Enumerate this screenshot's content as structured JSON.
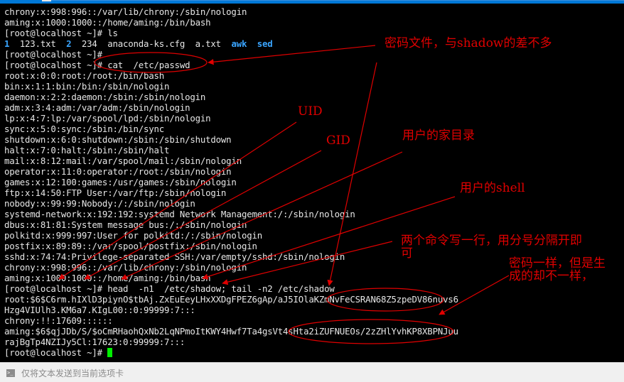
{
  "terminal": {
    "lines": [
      "chrony:x:998:996::/var/lib/chrony:/sbin/nologin",
      "aming:x:1000:1000::/home/aming:/bin/bash",
      "[root@localhost ~]# ls",
      "__LS__",
      "[root@localhost ~]#",
      "[root@localhost ~]# cat  /etc/passwd",
      "root:x:0:0:root:/root:/bin/bash",
      "bin:x:1:1:bin:/bin:/sbin/nologin",
      "daemon:x:2:2:daemon:/sbin:/sbin/nologin",
      "adm:x:3:4:adm:/var/adm:/sbin/nologin",
      "lp:x:4:7:lp:/var/spool/lpd:/sbin/nologin",
      "sync:x:5:0:sync:/sbin:/bin/sync",
      "shutdown:x:6:0:shutdown:/sbin:/sbin/shutdown",
      "halt:x:7:0:halt:/sbin:/sbin/halt",
      "mail:x:8:12:mail:/var/spool/mail:/sbin/nologin",
      "operator:x:11:0:operator:/root:/sbin/nologin",
      "games:x:12:100:games:/usr/games:/sbin/nologin",
      "ftp:x:14:50:FTP User:/var/ftp:/sbin/nologin",
      "nobody:x:99:99:Nobody:/:/sbin/nologin",
      "systemd-network:x:192:192:systemd Network Management:/:/sbin/nologin",
      "dbus:x:81:81:System message bus:/:/sbin/nologin",
      "polkitd:x:999:997:User for polkitd:/:/sbin/nologin",
      "postfix:x:89:89::/var/spool/postfix:/sbin/nologin",
      "sshd:x:74:74:Privilege-separated SSH:/var/empty/sshd:/sbin/nologin",
      "chrony:x:998:996::/var/lib/chrony:/sbin/nologin",
      "aming:x:1000:1000::/home/aming:/bin/bash",
      "[root@localhost ~]# head  -n1  /etc/shadow; tail -n2 /etc/shadow",
      "root:$6$C6rm.hIXlD3piynO$tbAj.ZxEuEeyLHxXXDgFPEZ6gAp/aJ5IOlaKZmNvFeCSRAN68Z5zpeDV86nuvs6",
      "Hzg4VIUlh3.KM6a7.KIgL00::0:99999:7:::",
      "chrony:!!:17609::::::",
      "aming:$6$qjJDb/S/$oCmRHaohQxNb2LqNPmoItKWY4Hwf7Ta4gsVt4sHta2iZUFNUEOs/2zZHlYvhKP8XBPNJuu",
      "rajBgTp4NZIJy5Cl:17623:0:99999:7:::"
    ],
    "ls_output": [
      {
        "text": "1",
        "dir": true
      },
      {
        "text": "  123.txt  ",
        "dir": false
      },
      {
        "text": "2",
        "dir": true
      },
      {
        "text": "  234  anaconda-ks.cfg  a.txt  ",
        "dir": false
      },
      {
        "text": "awk",
        "dir": true
      },
      {
        "text": "  ",
        "dir": false
      },
      {
        "text": "sed",
        "dir": true
      }
    ],
    "prompt": "[root@localhost ~]# ",
    "colors": {
      "text": "#e6e6e6",
      "directory": "#3aa5ff",
      "cursor": "#00ee00",
      "annotation": "#e00000"
    }
  },
  "annotations": {
    "passwd_file": "密码文件，与shadow的差不多",
    "uid": "UID",
    "gid": "GID",
    "home_dir": "用户的家目录",
    "user_shell": "用户的shell",
    "two_commands": "两个命令写一行，用分号分隔开即\n可",
    "same_password": "密码一样，但是生\n成的却不一样，"
  },
  "bottom_bar": {
    "icon": "terminal-icon",
    "icon_glyph": ">_",
    "label": "仅将文本发送到当前选项卡"
  }
}
